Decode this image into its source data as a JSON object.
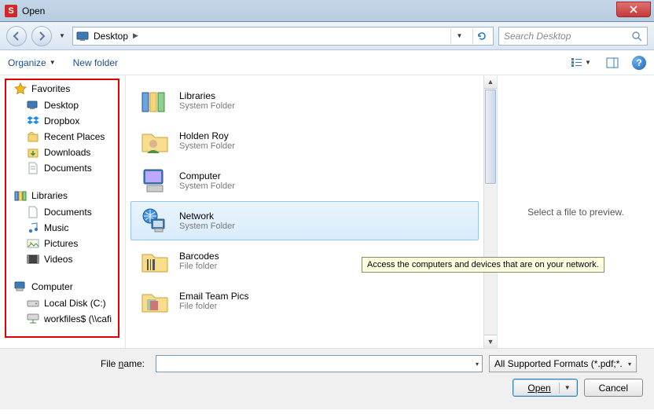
{
  "window": {
    "title": "Open",
    "close_icon": "close"
  },
  "nav": {
    "back": "back",
    "forward": "forward"
  },
  "address": {
    "location": "Desktop",
    "refresh_icon": "refresh"
  },
  "search": {
    "placeholder": "Search Desktop"
  },
  "toolbar": {
    "organize": "Organize",
    "new_folder": "New folder",
    "help": "?"
  },
  "sidebar": {
    "favorites": {
      "label": "Favorites",
      "items": [
        "Desktop",
        "Dropbox",
        "Recent Places",
        "Downloads",
        "Documents"
      ]
    },
    "libraries": {
      "label": "Libraries",
      "items": [
        "Documents",
        "Music",
        "Pictures",
        "Videos"
      ]
    },
    "computer": {
      "label": "Computer",
      "items": [
        "Local Disk (C:)",
        "workfiles$ (\\\\cafi"
      ]
    }
  },
  "files": [
    {
      "name": "Libraries",
      "sub": "System Folder"
    },
    {
      "name": "Holden Roy",
      "sub": "System Folder"
    },
    {
      "name": "Computer",
      "sub": "System Folder"
    },
    {
      "name": "Network",
      "sub": "System Folder"
    },
    {
      "name": "Barcodes",
      "sub": "File folder"
    },
    {
      "name": "Email Team Pics",
      "sub": "File folder"
    }
  ],
  "tooltip": "Access the computers and devices that are on your network.",
  "preview": {
    "text": "Select a file to preview."
  },
  "footer": {
    "filename_label_pre": "File ",
    "filename_label_ul": "n",
    "filename_label_post": "ame:",
    "filename_value": "",
    "filter": "All Supported Formats (*.pdf;*.",
    "open": "Open",
    "cancel": "Cancel"
  }
}
